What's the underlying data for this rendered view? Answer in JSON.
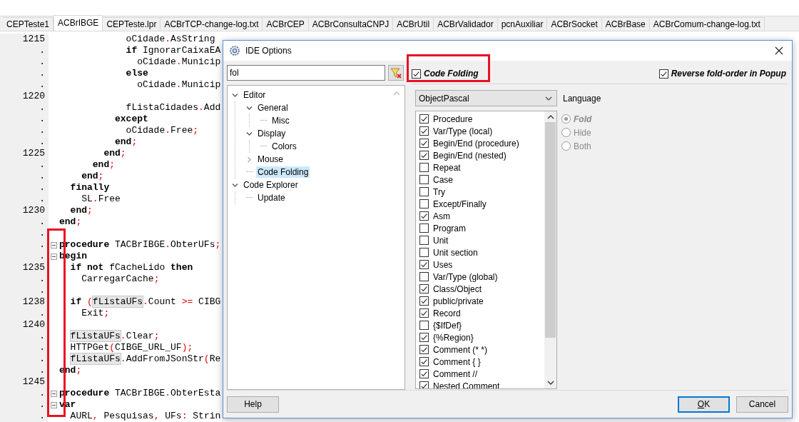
{
  "editor_tabs": [
    {
      "label": "CEPTeste1",
      "selected": false
    },
    {
      "label": "ACBrIBGE",
      "selected": true
    },
    {
      "label": "CEPTeste.lpr",
      "selected": false
    },
    {
      "label": "ACBrTCP-change-log.txt",
      "selected": false
    },
    {
      "label": "ACBrCEP",
      "selected": false
    },
    {
      "label": "ACBrConsultaCNPJ",
      "selected": false
    },
    {
      "label": "ACBrUtil",
      "selected": false
    },
    {
      "label": "ACBrValidador",
      "selected": false
    },
    {
      "label": "pcnAuxiliar",
      "selected": false
    },
    {
      "label": "ACBrSocket",
      "selected": false
    },
    {
      "label": "ACBrBase",
      "selected": false
    },
    {
      "label": "ACBrComum-change-log.txt",
      "selected": false
    }
  ],
  "editor": {
    "lines": [
      {
        "number": "1215",
        "fold_marker": false,
        "segs": [
          {
            "t": "            oCidade",
            "kind": "id"
          },
          {
            "t": ".",
            "kind": "sym"
          },
          {
            "t": "AsString",
            "kind": "id"
          }
        ]
      },
      {
        "number": ".",
        "fold_marker": false,
        "segs": [
          {
            "t": "            if",
            "kind": "kw"
          },
          {
            "t": " IgnorarCaixaEA",
            "kind": "id"
          }
        ]
      },
      {
        "number": ".",
        "fold_marker": false,
        "segs": [
          {
            "t": "              oCidade",
            "kind": "id"
          },
          {
            "t": ".",
            "kind": "sym"
          },
          {
            "t": "Municip",
            "kind": "id"
          }
        ]
      },
      {
        "number": ".",
        "fold_marker": false,
        "segs": [
          {
            "t": "            else",
            "kind": "kw"
          }
        ]
      },
      {
        "number": ".",
        "fold_marker": false,
        "segs": [
          {
            "t": "              oCidade",
            "kind": "id"
          },
          {
            "t": ".",
            "kind": "sym"
          },
          {
            "t": "Municip",
            "kind": "id"
          }
        ]
      },
      {
        "number": "1220",
        "fold_marker": false
      },
      {
        "number": ".",
        "fold_marker": false,
        "segs": [
          {
            "t": "            fListaCidades",
            "kind": "id"
          },
          {
            "t": ".",
            "kind": "sym"
          },
          {
            "t": "Add",
            "kind": "id"
          }
        ]
      },
      {
        "number": ".",
        "fold_marker": false,
        "segs": [
          {
            "t": "          except",
            "kind": "kw"
          }
        ]
      },
      {
        "number": ".",
        "fold_marker": false,
        "segs": [
          {
            "t": "            oCidade",
            "kind": "id"
          },
          {
            "t": ".",
            "kind": "sym"
          },
          {
            "t": "Free",
            "kind": "id"
          },
          {
            "t": ";",
            "kind": "sym"
          }
        ]
      },
      {
        "number": ".",
        "fold_marker": false,
        "segs": [
          {
            "t": "          end",
            "kind": "kw"
          },
          {
            "t": ";",
            "kind": "sym"
          }
        ]
      },
      {
        "number": "1225",
        "fold_marker": false,
        "segs": [
          {
            "t": "        end",
            "kind": "kw"
          },
          {
            "t": ";",
            "kind": "sym"
          }
        ]
      },
      {
        "number": ".",
        "fold_marker": false,
        "segs": [
          {
            "t": "      end",
            "kind": "kw"
          },
          {
            "t": ";",
            "kind": "sym"
          }
        ]
      },
      {
        "number": ".",
        "fold_marker": false,
        "segs": [
          {
            "t": "    end",
            "kind": "kw"
          },
          {
            "t": ";",
            "kind": "sym"
          }
        ]
      },
      {
        "number": ".",
        "fold_marker": false,
        "segs": [
          {
            "t": "  finally",
            "kind": "kw"
          }
        ]
      },
      {
        "number": ".",
        "fold_marker": false,
        "segs": [
          {
            "t": "    SL",
            "kind": "id"
          },
          {
            "t": ".",
            "kind": "sym"
          },
          {
            "t": "Free",
            "kind": "id"
          }
        ]
      },
      {
        "number": "1230",
        "fold_marker": false,
        "segs": [
          {
            "t": "  end",
            "kind": "kw"
          },
          {
            "t": ";",
            "kind": "sym"
          }
        ]
      },
      {
        "number": ".",
        "fold_marker": false,
        "segs": [
          {
            "t": "end",
            "kind": "kw"
          },
          {
            "t": ";",
            "kind": "sym"
          }
        ]
      },
      {
        "number": ".",
        "fold_marker": false
      },
      {
        "number": ".",
        "fold_marker": true,
        "segs": [
          {
            "t": "procedure",
            "kind": "kw"
          },
          {
            "t": " TACBrIBGE",
            "kind": "id"
          },
          {
            "t": ".",
            "kind": "sym"
          },
          {
            "t": "ObterUFs",
            "kind": "id"
          },
          {
            "t": ";",
            "kind": "sym"
          }
        ]
      },
      {
        "number": ".",
        "fold_marker": true,
        "segs": [
          {
            "t": "begin",
            "kind": "kw"
          }
        ]
      },
      {
        "number": "1235",
        "fold_marker": false,
        "segs": [
          {
            "t": "  if not",
            "kind": "kw"
          },
          {
            "t": " fCacheLido ",
            "kind": "id"
          },
          {
            "t": "then",
            "kind": "kw"
          }
        ]
      },
      {
        "number": ".",
        "fold_marker": false,
        "segs": [
          {
            "t": "    CarregarCache",
            "kind": "id"
          },
          {
            "t": ";",
            "kind": "sym"
          }
        ]
      },
      {
        "number": ".",
        "fold_marker": false
      },
      {
        "number": "1238",
        "fold_marker": false,
        "segs": [
          {
            "t": "  if ",
            "kind": "kw"
          },
          {
            "t": "(",
            "kind": "sym"
          },
          {
            "t": "fListaUFs",
            "kind": "hl"
          },
          {
            "t": ".",
            "kind": "sym"
          },
          {
            "t": "Count ",
            "kind": "id"
          },
          {
            "t": ">=",
            "kind": "sym"
          },
          {
            "t": " CIBG",
            "kind": "id"
          }
        ]
      },
      {
        "number": ".",
        "fold_marker": false,
        "segs": [
          {
            "t": "    Exit",
            "kind": "id"
          },
          {
            "t": ";",
            "kind": "sym"
          }
        ]
      },
      {
        "number": "1240",
        "fold_marker": false
      },
      {
        "number": ".",
        "fold_marker": false,
        "segs": [
          {
            "t": "  fListaUFs",
            "kind": "hl"
          },
          {
            "t": ".",
            "kind": "sym"
          },
          {
            "t": "Clear",
            "kind": "id"
          },
          {
            "t": ";",
            "kind": "sym"
          }
        ]
      },
      {
        "number": ".",
        "fold_marker": false,
        "segs": [
          {
            "t": "  HTTPGet",
            "kind": "id"
          },
          {
            "t": "(",
            "kind": "sym"
          },
          {
            "t": "CIBGE_URL_UF",
            "kind": "id"
          },
          {
            "t": ");",
            "kind": "sym"
          }
        ]
      },
      {
        "number": ".",
        "fold_marker": false,
        "segs": [
          {
            "t": "  fListaUFs",
            "kind": "hl"
          },
          {
            "t": ".",
            "kind": "sym"
          },
          {
            "t": "AddFromJSonStr",
            "kind": "id"
          },
          {
            "t": "(",
            "kind": "sym"
          },
          {
            "t": "Re",
            "kind": "id"
          }
        ]
      },
      {
        "number": ".",
        "fold_marker": false,
        "segs": [
          {
            "t": "end",
            "kind": "kw"
          },
          {
            "t": ";",
            "kind": "sym"
          }
        ]
      },
      {
        "number": "1245",
        "fold_marker": false
      },
      {
        "number": ".",
        "fold_marker": true,
        "segs": [
          {
            "t": "procedure",
            "kind": "kw"
          },
          {
            "t": " TACBrIBGE",
            "kind": "id"
          },
          {
            "t": ".",
            "kind": "sym"
          },
          {
            "t": "ObterEsta",
            "kind": "id"
          }
        ]
      },
      {
        "number": ".",
        "fold_marker": true,
        "segs": [
          {
            "t": "var",
            "kind": "kw"
          }
        ]
      },
      {
        "number": ".",
        "fold_marker": false,
        "segs": [
          {
            "t": "  AURL",
            "kind": "id"
          },
          {
            "t": ",",
            "kind": "sym"
          },
          {
            "t": " Pesquisas",
            "kind": "id"
          },
          {
            "t": ",",
            "kind": "sym"
          },
          {
            "t": " UFs",
            "kind": "id"
          },
          {
            "t": ":",
            "kind": "sym"
          },
          {
            "t": " Strin",
            "kind": "id"
          }
        ]
      }
    ]
  },
  "dialog": {
    "title": "IDE Options",
    "search": {
      "value": "fol"
    },
    "tree": [
      {
        "label": "Editor",
        "expanded": true,
        "selected": false,
        "children": [
          {
            "label": "General",
            "expanded": true,
            "selected": false,
            "children": [
              {
                "label": "Misc",
                "selected": false
              }
            ]
          },
          {
            "label": "Display",
            "expanded": true,
            "selected": false,
            "children": [
              {
                "label": "Colors",
                "selected": false
              }
            ]
          },
          {
            "label": "Mouse",
            "expanded": false,
            "selected": false
          },
          {
            "label": "Code Folding",
            "selected": true
          }
        ]
      },
      {
        "label": "Code Explorer",
        "expanded": true,
        "selected": false,
        "children": [
          {
            "label": "Update",
            "selected": false
          }
        ]
      }
    ],
    "code_folding": {
      "label": "Code Folding",
      "checked": true
    },
    "reverse_fold_order": {
      "label": "Reverse fold-order in Popup",
      "checked": true
    },
    "language": {
      "value": "ObjectPascal",
      "label": "Language"
    },
    "fold_items": [
      {
        "label": "Procedure",
        "checked": true
      },
      {
        "label": "Var/Type (local)",
        "checked": true
      },
      {
        "label": "Begin/End (procedure)",
        "checked": true
      },
      {
        "label": "Begin/End (nested)",
        "checked": true
      },
      {
        "label": "Repeat",
        "checked": false
      },
      {
        "label": "Case",
        "checked": false
      },
      {
        "label": "Try",
        "checked": false
      },
      {
        "label": "Except/Finally",
        "checked": false
      },
      {
        "label": "Asm",
        "checked": true
      },
      {
        "label": "Program",
        "checked": false
      },
      {
        "label": "Unit",
        "checked": false
      },
      {
        "label": "Unit section",
        "checked": false
      },
      {
        "label": "Uses",
        "checked": true
      },
      {
        "label": "Var/Type (global)",
        "checked": false
      },
      {
        "label": "Class/Object",
        "checked": true
      },
      {
        "label": "public/private",
        "checked": true
      },
      {
        "label": "Record",
        "checked": true
      },
      {
        "label": "{$IfDef}",
        "checked": false
      },
      {
        "label": "{%Region}",
        "checked": true
      },
      {
        "label": "Comment (* *)",
        "checked": true
      },
      {
        "label": "Comment { }",
        "checked": true
      },
      {
        "label": "Comment //",
        "checked": true
      },
      {
        "label": "Nested Comment",
        "checked": true
      }
    ],
    "fold_options": [
      {
        "label": "Fold",
        "selected": true,
        "disabled": true
      },
      {
        "label": "Hide",
        "selected": false,
        "disabled": true
      },
      {
        "label": "Both",
        "selected": false,
        "disabled": true
      }
    ],
    "buttons": {
      "help": "Help",
      "ok": "OK",
      "cancel": "Cancel"
    }
  }
}
